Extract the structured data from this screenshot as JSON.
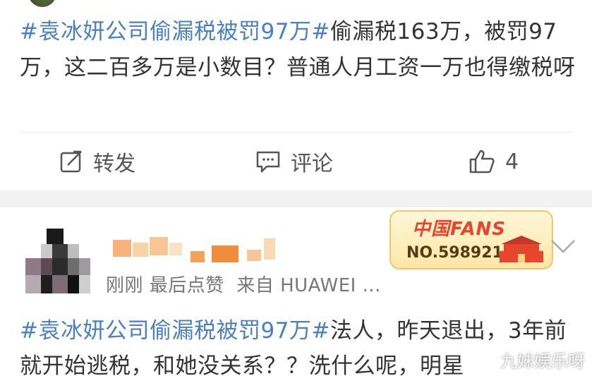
{
  "post": {
    "hashtag": "#袁冰妍公司偷漏税被罚97万#",
    "body": "偷漏税163万，被罚97万，这二百多万是小数目？普通人月工资一万也得缴税呀"
  },
  "actions": {
    "repost_label": "转发",
    "comment_label": "评论",
    "like_count": "4"
  },
  "comment": {
    "meta_time": "刚刚",
    "meta_text": "最后点赞",
    "meta_source": "来自 HUAWEI ...",
    "badge_title": "中国FANS",
    "badge_number": "NO.5989211",
    "hashtag": "#袁冰妍公司偷漏税被罚97万#",
    "body": "法人，昨天退出，3年前就开始逃税，和她没关系？？洗什么呢，明星"
  },
  "watermark": "九妹娱乐呀",
  "colors": {
    "hashtag": "#4a7fc1",
    "badge_red": "#e8452f",
    "separator": "#f2f2f2"
  },
  "icons": [
    "repost-icon",
    "comment-icon",
    "like-icon",
    "chevron-down-icon",
    "gate-icon"
  ]
}
